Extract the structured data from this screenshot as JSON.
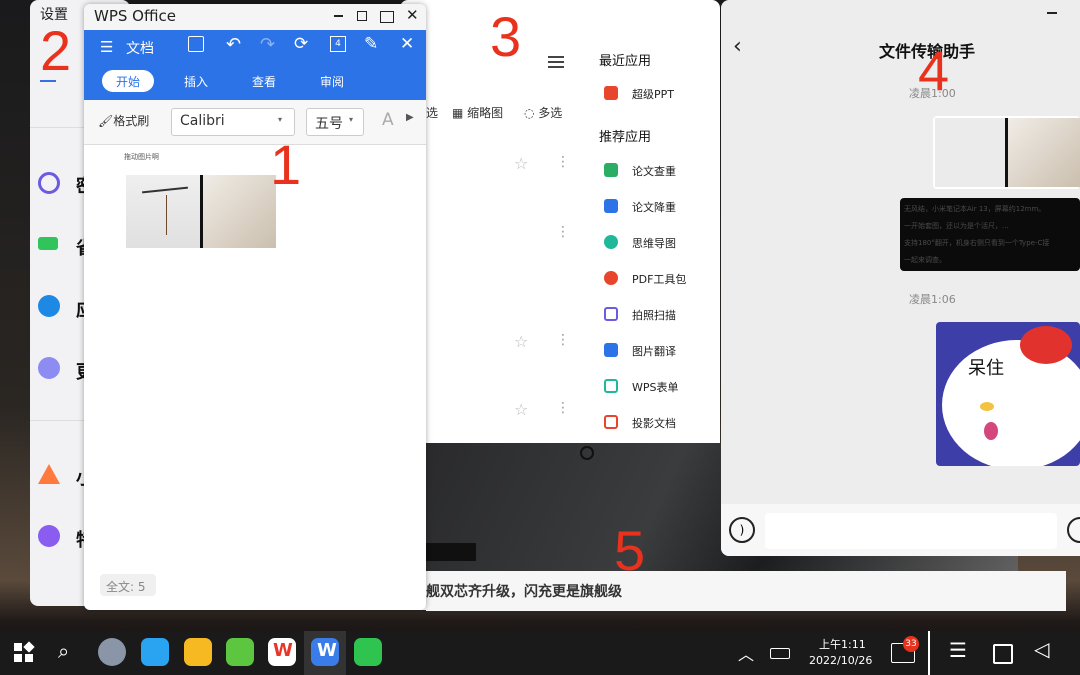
{
  "settings": {
    "title": "设置",
    "items": [
      {
        "label": "密",
        "icon": "fingerprint-icon",
        "color": "#6b5be0"
      },
      {
        "label": "省",
        "icon": "battery-icon",
        "color": "#31c45c"
      },
      {
        "label": "应",
        "icon": "gear-icon",
        "color": "#1e88e5"
      },
      {
        "label": "更",
        "icon": "more-icon",
        "color": "#7e7ef0"
      },
      {
        "label": "小",
        "icon": "xiaoyi-icon",
        "color": "#ff7a3c"
      },
      {
        "label": "特",
        "icon": "special-icon",
        "color": "#8a5cf0"
      }
    ]
  },
  "file_window": {
    "thumb_label": "缩略图",
    "multi_select_label": "多选",
    "recent_header": "最近应用",
    "recent_items": [
      {
        "label": "超级PPT",
        "color": "#e8462c"
      }
    ],
    "recommend_header": "推荐应用",
    "recommend_items": [
      {
        "label": "论文查重",
        "color": "#2bae64"
      },
      {
        "label": "论文降重",
        "color": "#2b73e6"
      },
      {
        "label": "思维导图",
        "color": "#20b89a"
      },
      {
        "label": "PDF工具包",
        "color": "#e8462c"
      },
      {
        "label": "拍照扫描",
        "color": "#6b5be0"
      },
      {
        "label": "图片翻译",
        "color": "#2b73e6"
      },
      {
        "label": "WPS表单",
        "color": "#20b89a"
      },
      {
        "label": "投影文档",
        "color": "#e8462c"
      }
    ],
    "bottom_text": "舰双芯齐升级，闪充更是旗舰级"
  },
  "wps": {
    "title": "WPS Office",
    "doc_label": "文档",
    "tabs": [
      "开始",
      "插入",
      "查看",
      "审阅"
    ],
    "active_tab": "开始",
    "format_painter": "格式刷",
    "font_name": "Calibri",
    "font_size": "五号",
    "drag_hint": "拖动图片啊",
    "word_count": "全文: 5",
    "accent": "#2b73e6"
  },
  "chat": {
    "title": "文件传输助手",
    "time1": "凌晨1:00",
    "time2": "凌晨1:06",
    "sticker_text": "呆住",
    "dark_text_lines": [
      "无风结，小米笔记本Air 13，屏幕约12mm。",
      "一开始套图，还以为是个活尺，...",
      "支持180°翻开，机身右侧只看到一个Type-C接",
      "一起来调查。"
    ]
  },
  "taskbar": {
    "time": "上午1:11",
    "date": "2022/10/26",
    "badge": "33"
  },
  "annotations": [
    "1",
    "2",
    "3",
    "4",
    "5"
  ]
}
